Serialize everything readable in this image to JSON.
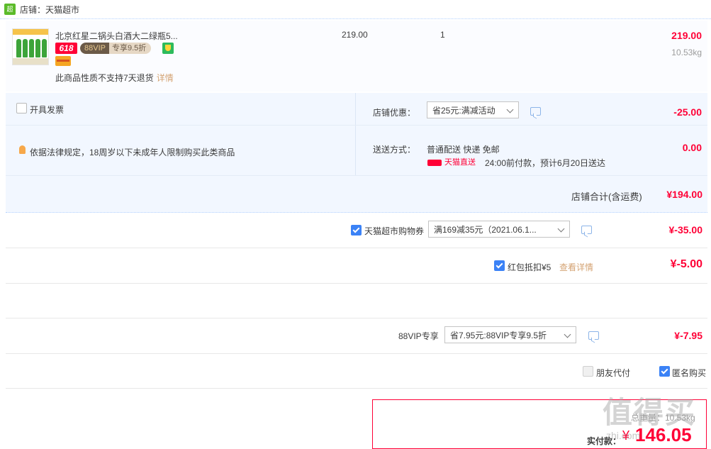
{
  "shop": {
    "logo_text": "超市",
    "name": "店铺：天猫超市"
  },
  "item": {
    "title": "北京红星二锅头白酒大二绿瓶5...",
    "badge_618": "618",
    "badge_vip_left": "88VIP",
    "badge_vip_right": "专享9.5折",
    "note": "此商品性质不支持7天退货",
    "note_link": "详情",
    "unit_price": "219.00",
    "quantity": "1",
    "subtotal": "219.00",
    "weight": "10.53kg"
  },
  "order": {
    "invoice_label": "开具发票",
    "legal_notice": "依据法律规定，18周岁以下未成年人限制购买此类商品",
    "shop_discount_label": "店铺优惠：",
    "shop_discount_select": "省25元:满减活动",
    "shop_discount_amount": "-25.00",
    "shipping_label": "送送方式：",
    "shipping_method": "普通配送 快递 免邮",
    "shipping_logo": "天猫直送",
    "shipping_time": "24:00前付款，预计6月20日送达",
    "shipping_amount": "0.00",
    "shop_total_label": "店铺合计(含运费)",
    "shop_total": "¥194.00"
  },
  "coupons": {
    "tmall_coupon_label": "天猫超市购物券",
    "tmall_coupon_select": "满169减35元（2021.06.1...",
    "tmall_coupon_amount": "¥-35.00",
    "redpacket_label": "红包抵扣¥5",
    "redpacket_link": "查看详情",
    "redpacket_amount": "¥-5.00",
    "vip_label": "88VIP专享",
    "vip_select": "省7.95元:88VIP专享9.5折",
    "vip_amount": "¥-7.95"
  },
  "options": {
    "friend_pay": "朋友代付",
    "anonymous": "匿名购买"
  },
  "payment": {
    "weight_line": "总重量：10.53kg",
    "actual_label": "实付款：",
    "currency": "¥",
    "amount": "146.05"
  },
  "watermark": {
    "main": "值得买",
    "sub": "zhi.com"
  }
}
